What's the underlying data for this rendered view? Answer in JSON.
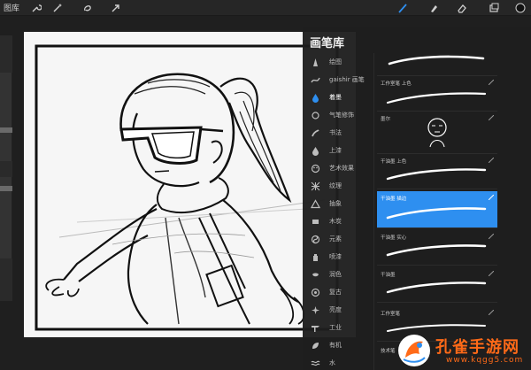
{
  "toolbar": {
    "gallery_label": "图库",
    "left_icons": [
      "wrench-icon",
      "magic-wand-icon",
      "selection-icon",
      "transform-arrow-icon"
    ],
    "right_tools": [
      "brush-tool-icon",
      "smudge-tool-icon",
      "eraser-tool-icon",
      "layers-icon",
      "color-swatch-icon"
    ],
    "accent_color": "#2e8ff0"
  },
  "brush_library": {
    "title": "画笔库",
    "categories": [
      {
        "label": "绘图",
        "icon": "pencil-drawing-icon"
      },
      {
        "label": "gaishir 画笔",
        "icon": "brush-stroke-icon"
      },
      {
        "label": "着墨",
        "icon": "ink-drop-icon",
        "active": true
      },
      {
        "label": "气笔修饰",
        "icon": "airbrush-icon"
      },
      {
        "label": "书法",
        "icon": "calligraphy-icon"
      },
      {
        "label": "上漆",
        "icon": "paint-drop-icon"
      },
      {
        "label": "艺术效果",
        "icon": "palette-icon"
      },
      {
        "label": "纹理",
        "icon": "texture-grid-icon"
      },
      {
        "label": "抽象",
        "icon": "triangle-icon"
      },
      {
        "label": "木炭",
        "icon": "charcoal-icon"
      },
      {
        "label": "元素",
        "icon": "element-yin-icon"
      },
      {
        "label": "喷漆",
        "icon": "spray-can-icon"
      },
      {
        "label": "润色",
        "icon": "touchup-icon"
      },
      {
        "label": "复古",
        "icon": "retro-icon"
      },
      {
        "label": "亮度",
        "icon": "sparkle-icon"
      },
      {
        "label": "工业",
        "icon": "industrial-icon"
      },
      {
        "label": "有机",
        "icon": "leaf-icon"
      },
      {
        "label": "水",
        "icon": "water-wave-icon"
      }
    ],
    "brushes": [
      {
        "label": ""
      },
      {
        "label": "工作室笔 上色"
      },
      {
        "label": "墨尔"
      },
      {
        "label": "干油墨 上色"
      },
      {
        "label": "干油墨 描边",
        "selected": true
      },
      {
        "label": "干油墨 实心"
      },
      {
        "label": "干油墨"
      },
      {
        "label": "工作室笔"
      },
      {
        "label": "技术笔"
      }
    ]
  },
  "watermark": {
    "title": "孔雀手游网",
    "url": "www.kqgg5.com"
  }
}
